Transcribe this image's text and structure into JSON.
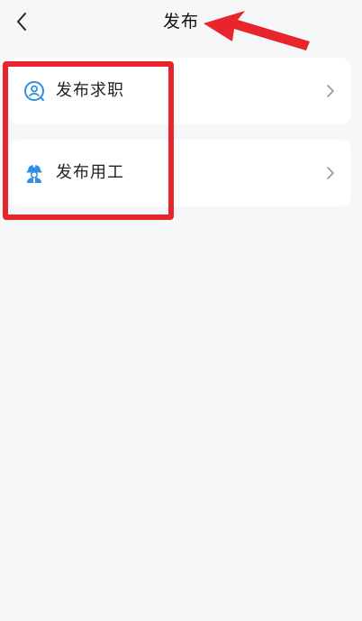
{
  "header": {
    "title": "发布"
  },
  "menu": {
    "items": [
      {
        "label": "发布求职",
        "icon": "job-seeker-icon"
      },
      {
        "label": "发布用工",
        "icon": "worker-helmet-icon"
      }
    ]
  },
  "colors": {
    "accent": "#2f8fe0",
    "annotation": "#e8242d",
    "background": "#f6f7f9",
    "card": "#ffffff"
  }
}
